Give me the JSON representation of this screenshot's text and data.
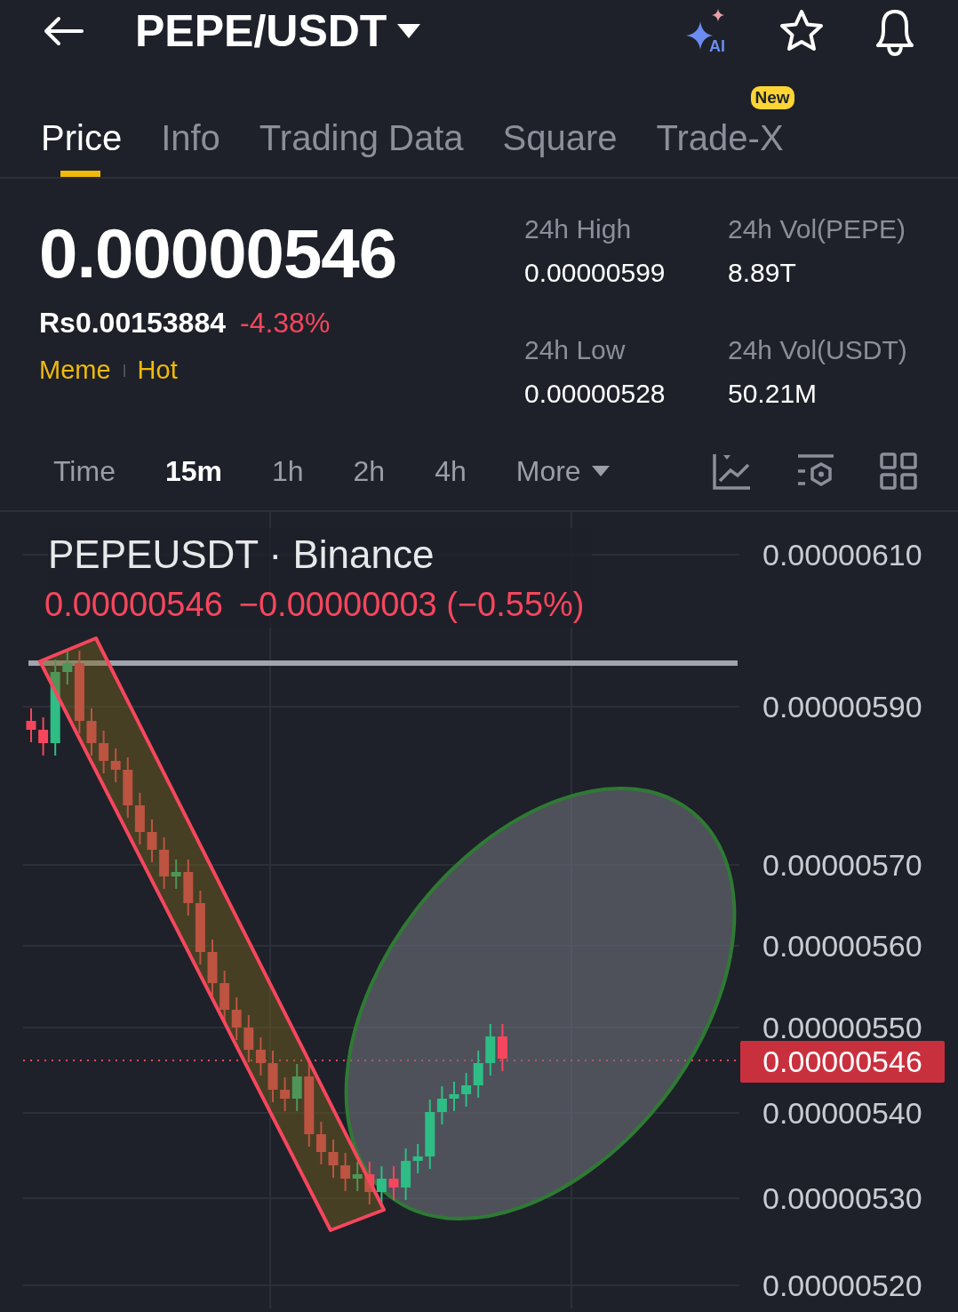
{
  "header": {
    "title": "PEPE/USDT",
    "ai_label": "AI"
  },
  "tabs": [
    {
      "label": "Price",
      "selected": true
    },
    {
      "label": "Info",
      "selected": false
    },
    {
      "label": "Trading Data",
      "selected": false
    },
    {
      "label": "Square",
      "selected": false
    },
    {
      "label": "Trade-X",
      "selected": false,
      "badge": "New"
    }
  ],
  "ticker": {
    "last_price": "0.00000546",
    "fiat_price": "Rs0.00153884",
    "change": "-4.38%",
    "tags": [
      "Meme",
      "Hot"
    ]
  },
  "stats": [
    {
      "label": "24h High",
      "value": "0.00000599"
    },
    {
      "label": "24h Vol(PEPE)",
      "value": "8.89T"
    },
    {
      "label": "24h Low",
      "value": "0.00000528"
    },
    {
      "label": "24h Vol(USDT)",
      "value": "50.21M"
    }
  ],
  "intervals": [
    {
      "label": "Time",
      "kind": "label",
      "selected": false
    },
    {
      "label": "15m",
      "kind": "interval",
      "selected": true
    },
    {
      "label": "1h",
      "kind": "interval",
      "selected": false
    },
    {
      "label": "2h",
      "kind": "interval",
      "selected": false
    },
    {
      "label": "4h",
      "kind": "interval",
      "selected": false
    },
    {
      "label": "More",
      "kind": "dropdown",
      "selected": false
    }
  ],
  "chart": {
    "title": "PEPEUSDT · Binance",
    "quote_price": "0.00000546",
    "quote_change": "−0.00000003 (−0.55%)",
    "axis_labels": [
      "0.00000610",
      "0.00000590",
      "0.00000570",
      "0.00000560",
      "0.00000550",
      "0.00000540",
      "0.00000530",
      "0.00000520"
    ],
    "last_price_label": "0.00000546"
  }
}
